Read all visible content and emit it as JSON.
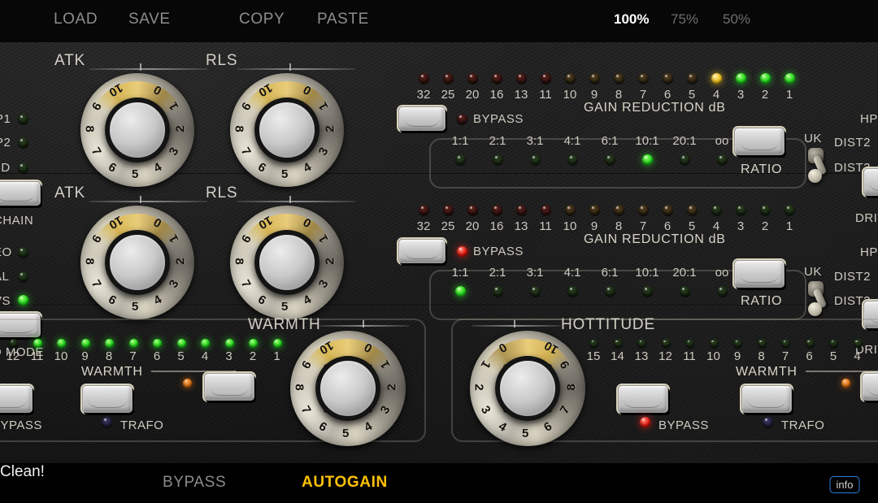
{
  "toolbar": {
    "load": "LOAD",
    "save": "SAVE",
    "copy": "COPY",
    "paste": "PASTE",
    "zoom_options": [
      "100%",
      "75%",
      "50%"
    ],
    "zoom_selected": "100%"
  },
  "left_rail": {
    "group1": {
      "leds": [
        {
          "label": "P1",
          "state": "off"
        },
        {
          "label": "P2",
          "state": "off"
        },
        {
          "label": "ND",
          "state": "off"
        }
      ],
      "button_label": "CHAIN"
    },
    "group2": {
      "leds": [
        {
          "label": "EO",
          "state": "off"
        },
        {
          "label": "AL",
          "state": "off"
        },
        {
          "label": "VS",
          "state": "on"
        }
      ],
      "button_label": "O MODE"
    }
  },
  "right_rail": {
    "row1": [
      "HP",
      "DIST2",
      "DIST3"
    ],
    "row2": [
      "HP",
      "DIST2",
      "DIST3"
    ],
    "drive_label": "DRIV"
  },
  "comp1": {
    "attack_label": "ATK",
    "attack_value": 2,
    "release_label": "RLS",
    "release_value": 2,
    "knob_scale": [
      "0",
      "1",
      "2",
      "3",
      "4",
      "5",
      "6",
      "7",
      "8",
      "9",
      "10"
    ],
    "bypass_label": "BYPASS",
    "bypass_state": "off",
    "meter_caption": "GAIN REDUCTION dB",
    "meter_scale": [
      "32",
      "25",
      "20",
      "16",
      "13",
      "11",
      "10",
      "9",
      "8",
      "7",
      "6",
      "5",
      "4",
      "3",
      "2",
      "1"
    ],
    "meter_states": [
      "off",
      "off",
      "off",
      "off",
      "off",
      "off",
      "off",
      "off",
      "off",
      "off",
      "off",
      "off",
      "amber",
      "on",
      "on",
      "on"
    ],
    "ratio_label": "RATIO",
    "ratio_scale": [
      "1:1",
      "2:1",
      "3:1",
      "4:1",
      "6:1",
      "10:1",
      "20:1",
      "oo"
    ],
    "ratio_selected": "10:1",
    "switch_label": "UK"
  },
  "comp2": {
    "attack_label": "ATK",
    "attack_value": 2,
    "release_label": "RLS",
    "release_value": 2,
    "knob_scale": [
      "0",
      "1",
      "2",
      "3",
      "4",
      "5",
      "6",
      "7",
      "8",
      "9",
      "10"
    ],
    "bypass_label": "BYPASS",
    "bypass_state": "on",
    "meter_caption": "GAIN REDUCTION dB",
    "meter_scale": [
      "32",
      "25",
      "20",
      "16",
      "13",
      "11",
      "10",
      "9",
      "8",
      "7",
      "6",
      "5",
      "4",
      "3",
      "2",
      "1"
    ],
    "meter_states": [
      "off",
      "off",
      "off",
      "off",
      "off",
      "off",
      "off",
      "off",
      "off",
      "off",
      "off",
      "off",
      "off",
      "off",
      "off",
      "off"
    ],
    "ratio_label": "RATIO",
    "ratio_scale": [
      "1:1",
      "2:1",
      "3:1",
      "4:1",
      "6:1",
      "10:1",
      "20:1",
      "oo"
    ],
    "ratio_selected": "1:1",
    "switch_label": "UK"
  },
  "warmth_left": {
    "title": "WARMTH",
    "meter_scale": [
      "12",
      "11",
      "10",
      "9",
      "8",
      "7",
      "6",
      "5",
      "4",
      "3",
      "2",
      "1"
    ],
    "meter_states": [
      "off",
      "on",
      "on",
      "on",
      "on",
      "on",
      "on",
      "on",
      "on",
      "on",
      "on",
      "on"
    ],
    "meter_caption": "WARMTH",
    "knob_value": 4,
    "knob_scale": [
      "0",
      "1",
      "2",
      "3",
      "4",
      "5",
      "6",
      "7",
      "8",
      "9",
      "10"
    ],
    "bypass_label": "BYPASS",
    "bypass_state": "off",
    "trafo_label": "TRAFO",
    "trafo_state": "off",
    "indicator_state": "on"
  },
  "warmth_right": {
    "title": "HOTTITUDE",
    "meter_scale": [
      "15",
      "14",
      "13",
      "12",
      "11",
      "10",
      "9",
      "8",
      "7",
      "6",
      "5",
      "4"
    ],
    "meter_states": [
      "off",
      "off",
      "off",
      "off",
      "off",
      "off",
      "off",
      "off",
      "off",
      "off",
      "off",
      "off"
    ],
    "meter_caption": "WARMTH",
    "knob_value": 0,
    "knob_scale": [
      "0",
      "1",
      "2",
      "3",
      "4",
      "5",
      "6",
      "7",
      "8",
      "9",
      "10"
    ],
    "bypass_label": "BYPASS",
    "bypass_state": "on",
    "trafo_label": "TRAFO",
    "trafo_state": "off",
    "indicator_state": "on"
  },
  "bottom": {
    "bypass": "BYPASS",
    "bypass_active": false,
    "autogain": "AUTOGAIN",
    "autogain_active": true,
    "status": "Clean!",
    "info": "info"
  },
  "colors": {
    "accent_amber": "#ffc107",
    "led_green": "#18d615",
    "led_red": "#e01008",
    "info_border": "#2f7fe0"
  }
}
